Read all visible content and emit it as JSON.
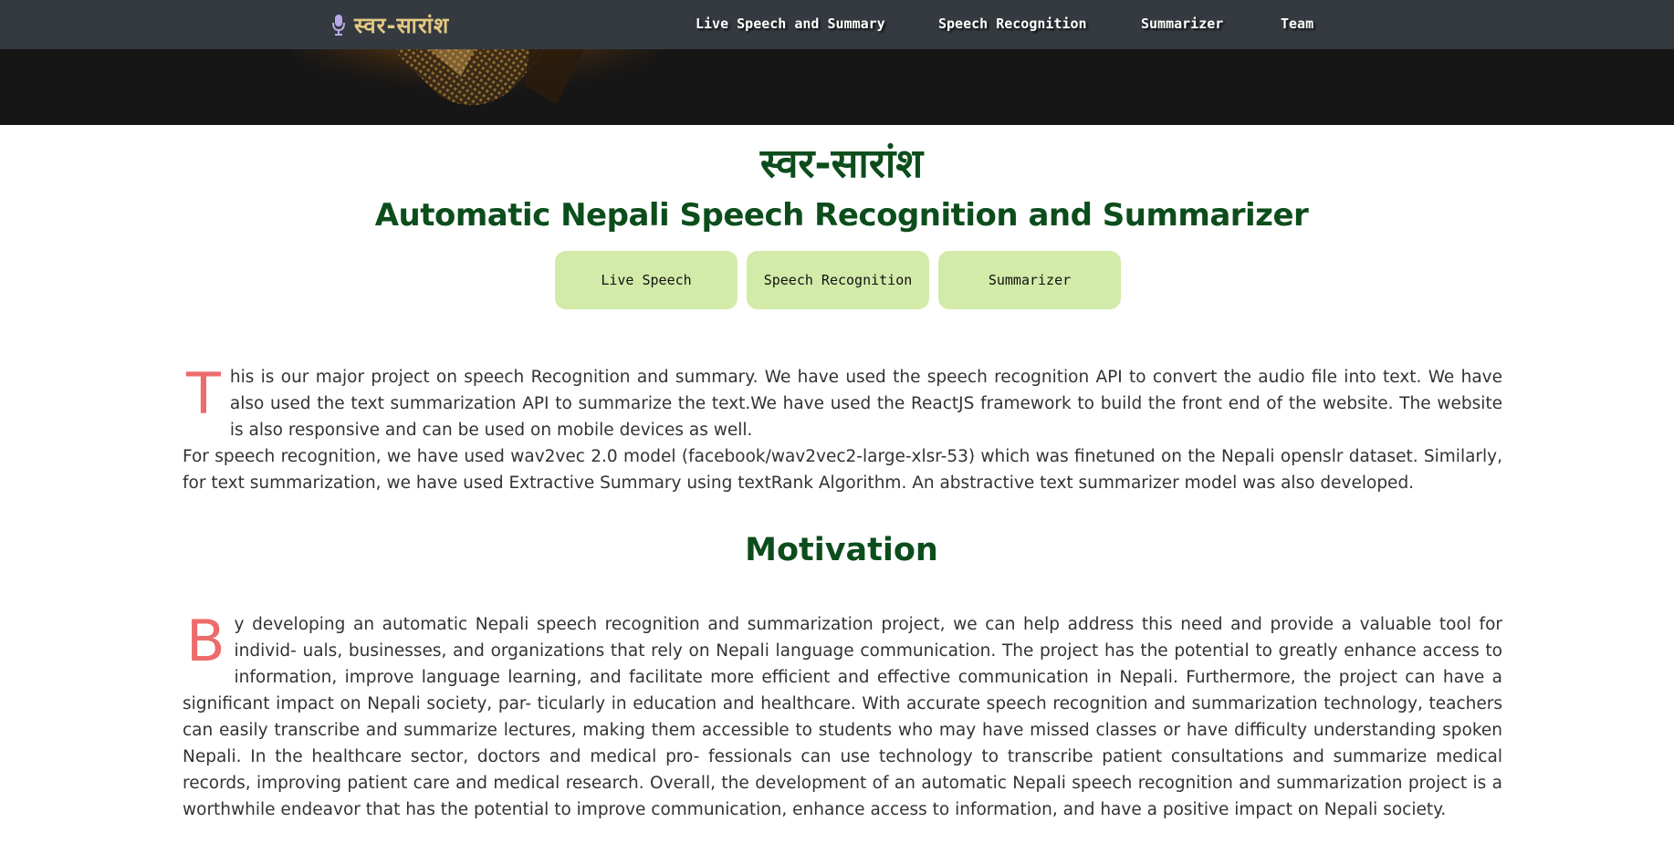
{
  "nav": {
    "brand": "स्वर-सारांश",
    "brand_icon": "microphone-icon",
    "links": [
      "Live Speech and Summary",
      "Speech Recognition",
      "Summarizer",
      "Team"
    ]
  },
  "header": {
    "title": "स्वर-सारांश",
    "subtitle": "Automatic Nepali Speech Recognition and Summarizer"
  },
  "buttons": [
    "Live Speech",
    "Speech Recognition",
    "Summarizer"
  ],
  "about": {
    "dropcap": "T",
    "text": "his is our major project on speech Recognition and summary. We have used the speech recognition API to convert the audio file into text. We have also used the text summarization API to summarize the text.We have used the ReactJS framework to build the front end of the website. The website is also responsive and can be used on mobile devices as well.",
    "text2": "For speech recognition, we have used wav2vec 2.0 model (facebook/wav2vec2-large-xlsr-53) which was finetuned on the Nepali openslr dataset. Similarly, for text summarization, we have used Extractive Summary using textRank Algorithm. An abstractive text summarizer model was also developed."
  },
  "motivation": {
    "title": "Motivation",
    "dropcap": "B",
    "text": "y developing an automatic Nepali speech recognition and summarization project, we can help address this need and provide a valuable tool for individ- uals, businesses, and organizations that rely on Nepali language communication. The project has the potential to greatly enhance access to information, improve language learning, and facilitate more efficient and effective communication in Nepali. Furthermore, the project can have a significant impact on Nepali society, par- ticularly in education and healthcare. With accurate speech recognition and summarization technology, teachers can easily transcribe and summarize lectures, making them accessible to students who may have missed classes or have difficulty understanding spoken Nepali. In the healthcare sector, doctors and medical pro- fessionals can use technology to transcribe patient consultations and summarize medical records, improving patient care and medical research. Overall, the development of an automatic Nepali speech recognition and summarization project is a worthwhile endeavor that has the potential to improve communication, enhance access to information, and have a positive impact on Nepali society."
  },
  "colors": {
    "navbar": "#343a40",
    "brand": "#e3c982",
    "heading": "#0c4d1c",
    "button": "#d2eba9",
    "dropcap": "#ee6b6b",
    "body_text": "#333333"
  }
}
